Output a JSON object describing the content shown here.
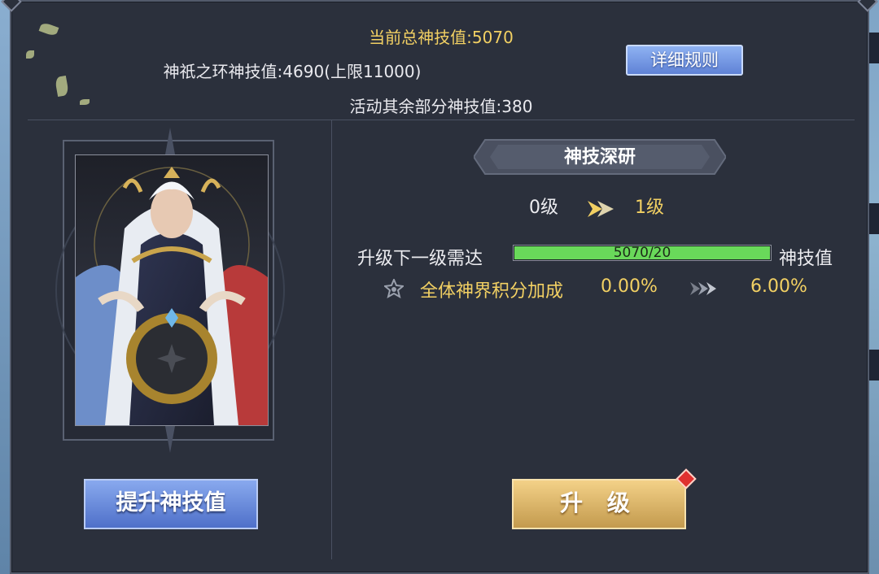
{
  "header": {
    "total_value": "当前总神技值:5070",
    "ring_value": "神祇之环神技值:4690(上限11000)",
    "other_value": "活动其余部分神技值:380",
    "rules_button": "详细规则"
  },
  "left": {
    "boost_button": "提升神技值"
  },
  "research": {
    "title": "神技深研",
    "level_from": "0级",
    "level_to": "1级",
    "requirement_label": "升级下一级需达",
    "progress_text": "5070/20",
    "progress_fraction": 1.0,
    "requirement_unit": "神技值",
    "bonus_label": "全体神界积分加成",
    "bonus_from": "0.00%",
    "bonus_to": "6.00%",
    "upgrade_button": "升 级"
  },
  "colors": {
    "panel_bg": "#2b303c",
    "gold_text": "#f2d063",
    "progress_green": "#69d95a",
    "blue_button": "#6b8cdf",
    "gold_button": "#d9b46a"
  },
  "icons": [
    "double-arrow-icon",
    "star-badge-icon",
    "chevron-right-double-icon",
    "notification-dot-icon"
  ]
}
